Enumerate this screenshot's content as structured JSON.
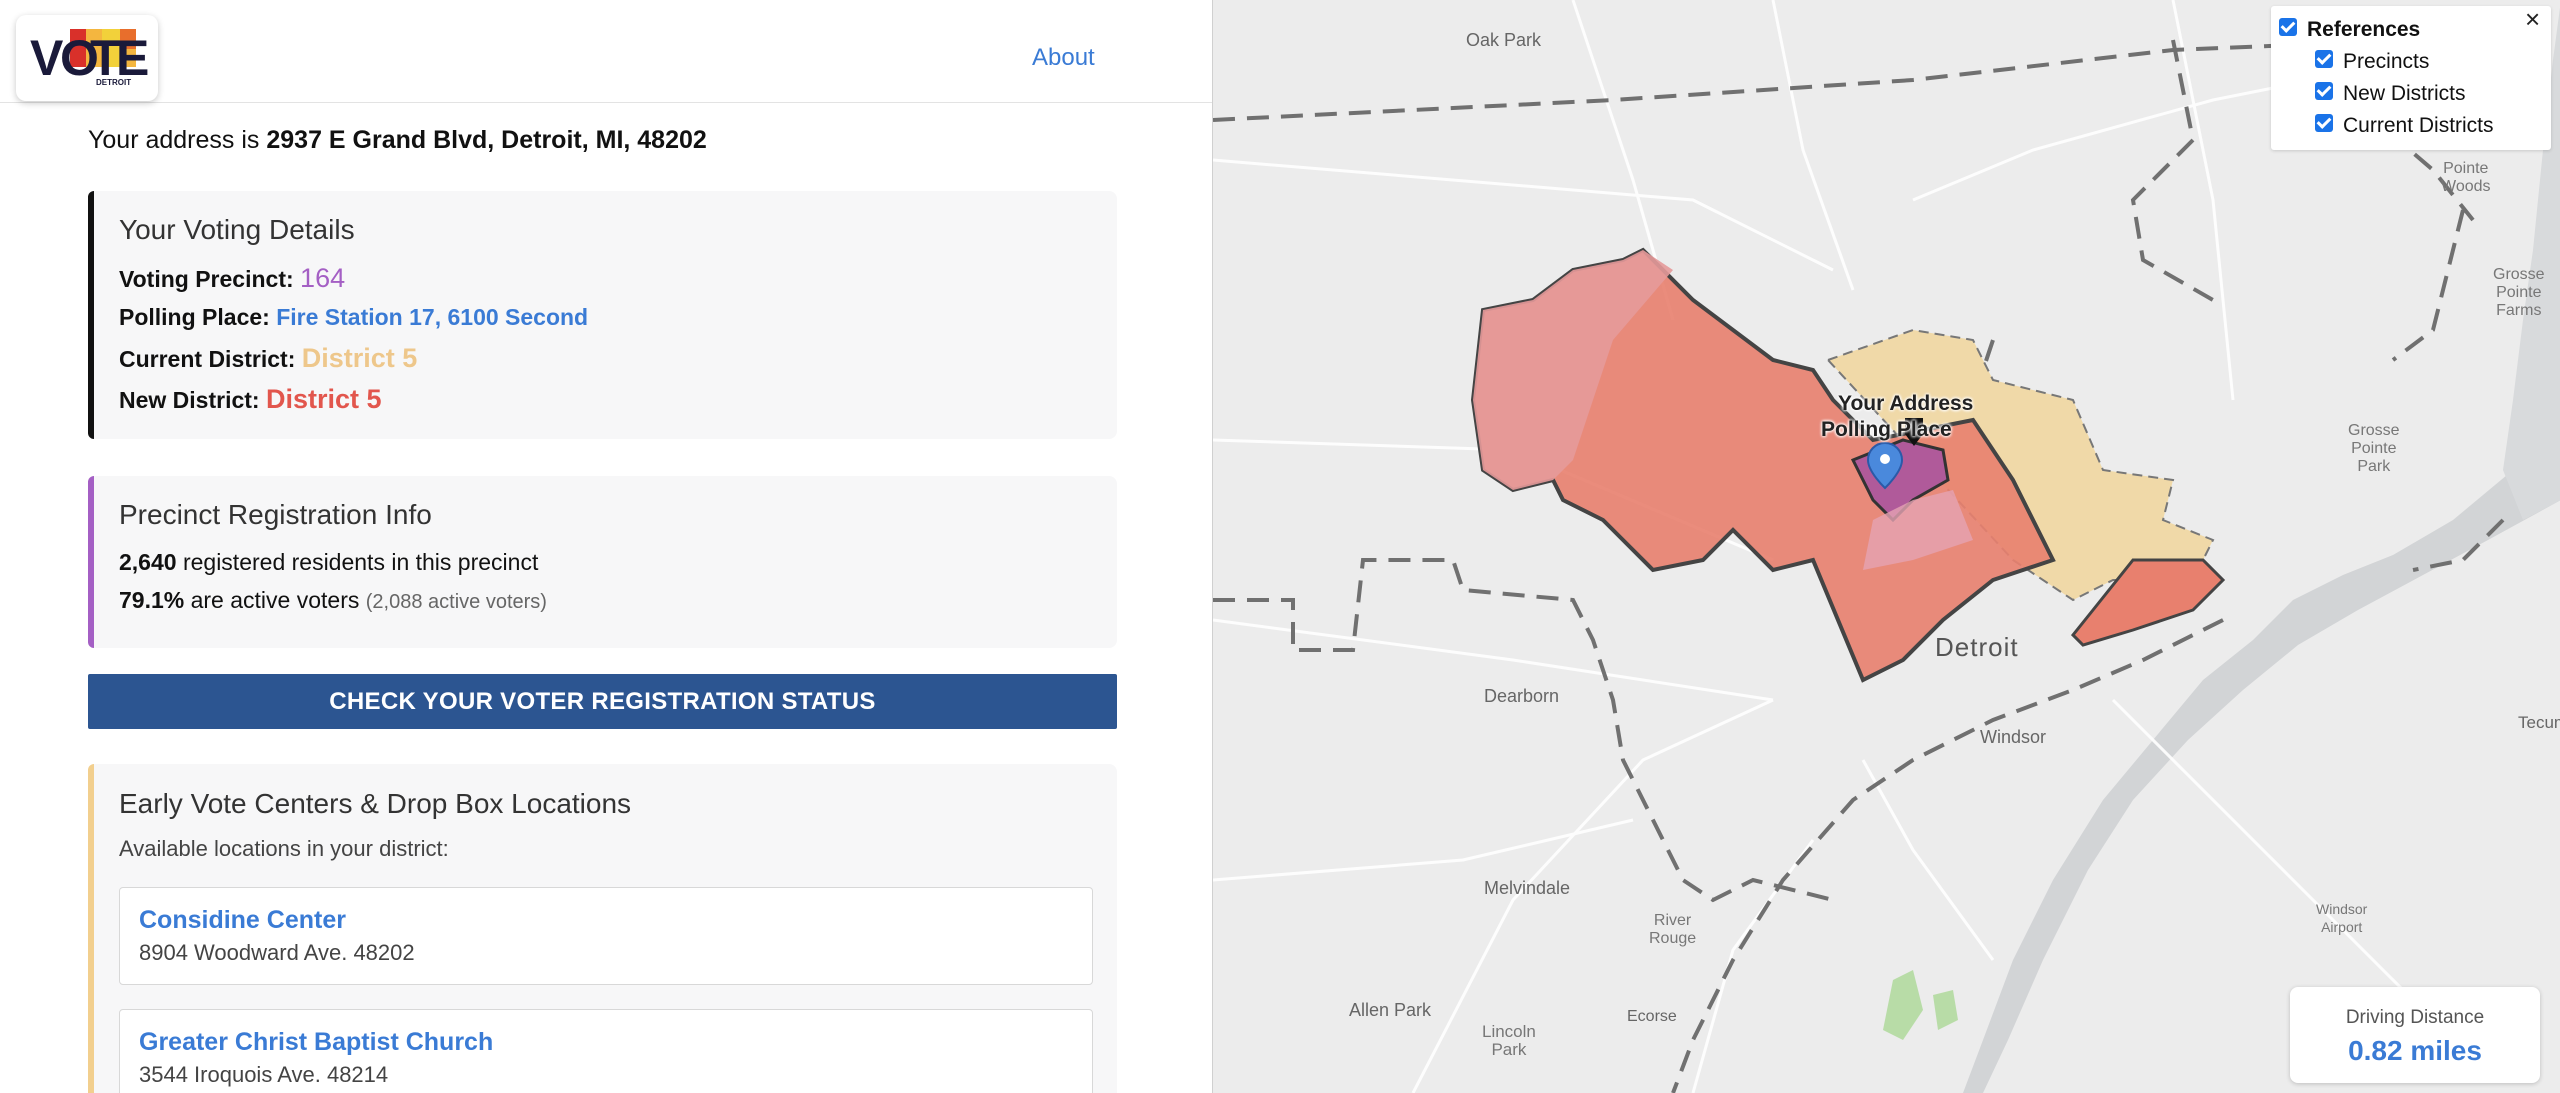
{
  "header": {
    "logo_text": "VOTE",
    "logo_subtext": "DETROIT",
    "about_label": "About"
  },
  "address": {
    "prefix": "Your address is",
    "value": "2937 E Grand Blvd, Detroit, MI, 48202"
  },
  "voting_details": {
    "title": "Your Voting Details",
    "precinct_label": "Voting Precinct:",
    "precinct_value": "164",
    "polling_label": "Polling Place:",
    "polling_value": "Fire Station 17, 6100 Second",
    "current_district_label": "Current District:",
    "current_district_value": "District 5",
    "new_district_label": "New District:",
    "new_district_value": "District 5"
  },
  "registration": {
    "title": "Precinct Registration Info",
    "registered_count": "2,640",
    "registered_text": "registered residents in this precinct",
    "active_pct": "79.1%",
    "active_text": "are active voters",
    "active_count": "(2,088 active voters)"
  },
  "check_button_label": "CHECK YOUR VOTER REGISTRATION STATUS",
  "early_vote": {
    "title": "Early Vote Centers & Drop Box Locations",
    "subtitle": "Available locations in your district:",
    "locations": [
      {
        "name": "Considine Center",
        "address": "8904 Woodward Ave. 48202"
      },
      {
        "name": "Greater Christ Baptist Church",
        "address": "3544 Iroquois Ave. 48214"
      }
    ]
  },
  "map": {
    "references_label": "References",
    "layers": [
      "Precincts",
      "New Districts",
      "Current Districts"
    ],
    "close_label": "×",
    "place_labels": {
      "oak_park": "Oak Park",
      "detroit": "Detroit",
      "dearborn": "Dearborn",
      "windsor": "Windsor",
      "melvindale": "Melvindale",
      "river_rouge": "River\nRouge",
      "ecorse": "Ecorse",
      "allen_park": "Allen Park",
      "lincoln_park": "Lincoln\nPark",
      "grosse_pointe": "Grosse\nPointe\nPark",
      "grosse_pointe_farms": "Grosse\nPointe\nFarms",
      "grosse_pointe_woods": "Pointe\nWoods",
      "windsor_airport": "Windsor\nAirport",
      "tecumseh": "Tecum"
    },
    "your_address_label": "Your Address",
    "polling_place_label": "Polling Place",
    "driving_distance_label": "Driving Distance",
    "driving_distance_value": "0.82 miles",
    "colors": {
      "new_district": "#e8806e",
      "current_district": "#f0d9a8",
      "precinct": "#b05a9a",
      "pin": "#4a89dc"
    }
  }
}
